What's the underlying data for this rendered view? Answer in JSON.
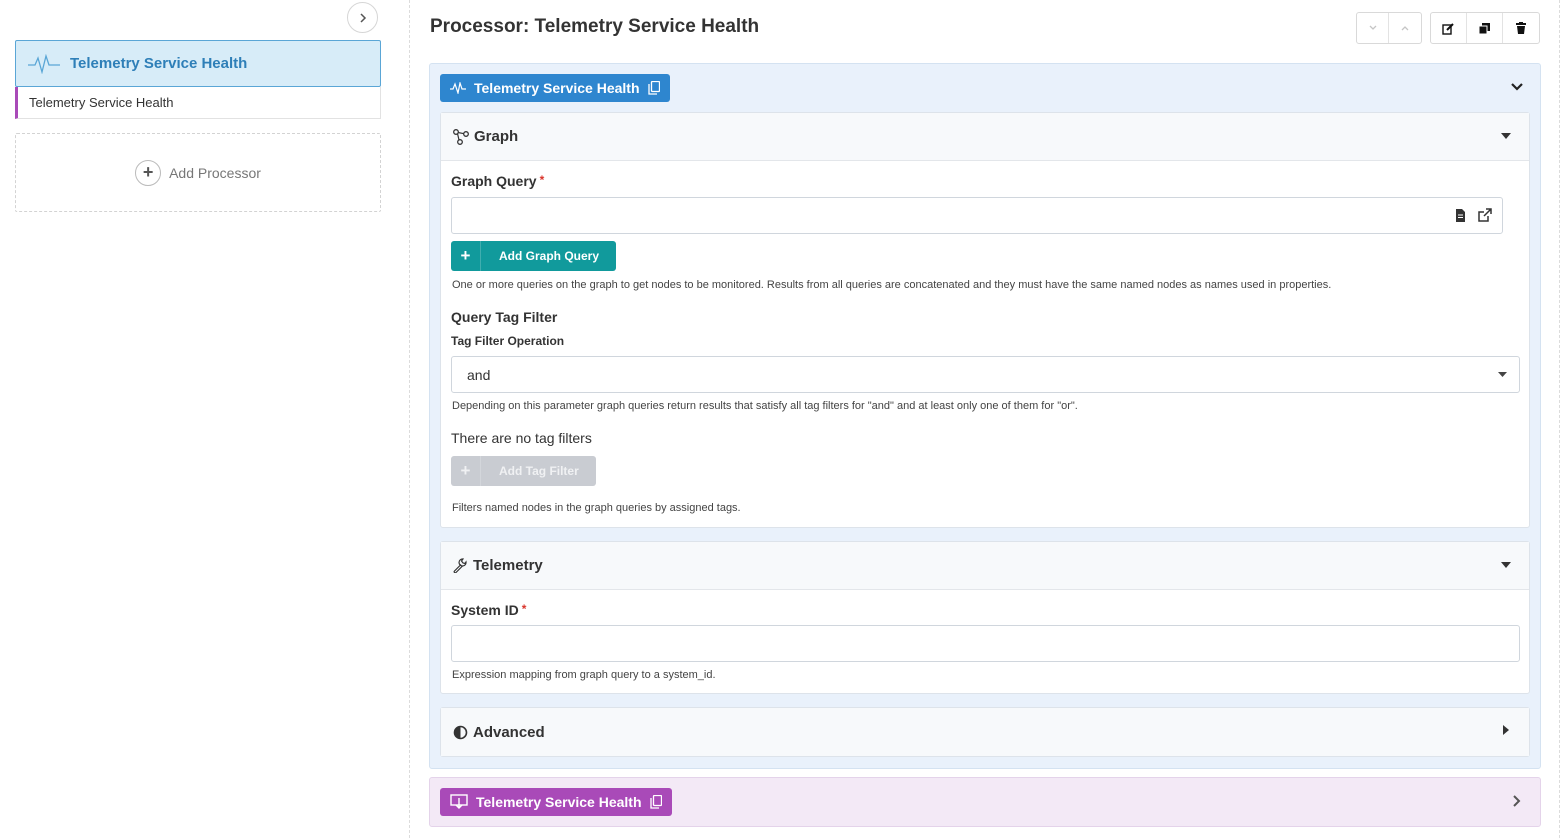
{
  "sidebar": {
    "processor": {
      "title": "Telemetry Service Health",
      "subtitle": "Telemetry Service Health"
    },
    "add_processor_label": "Add Processor"
  },
  "header": {
    "title": "Processor: Telemetry Service Health"
  },
  "processor_badge": {
    "label": "Telemetry Service Health"
  },
  "graph_section": {
    "title": "Graph",
    "graph_query_label": "Graph Query",
    "required_mark": "*",
    "graph_query_value": "",
    "add_graph_query_label": "Add Graph Query",
    "graph_query_help": "One or more queries on the graph to get nodes to be monitored. Results from all queries are concatenated and they must have the same named nodes as names used in properties.",
    "query_tag_filter_label": "Query Tag Filter",
    "tag_filter_operation_label": "Tag Filter Operation",
    "tag_filter_operation_value": "and",
    "tag_filter_operation_help": "Depending on this parameter graph queries return results that satisfy all tag filters for \"and\" and at least only one of them for \"or\".",
    "no_tag_filters_text": "There are no tag filters",
    "add_tag_filter_label": "Add Tag Filter",
    "tag_filter_help": "Filters named nodes in the graph queries by assigned tags."
  },
  "telemetry_section": {
    "title": "Telemetry",
    "system_id_label": "System ID",
    "required_mark": "*",
    "system_id_value": "",
    "system_id_help": "Expression mapping from graph query to a system_id."
  },
  "advanced_section": {
    "title": "Advanced"
  },
  "sink_badge": {
    "label": "Telemetry Service Health"
  },
  "colors": {
    "processor_blue": "#2e86cf",
    "sink_purple": "#a94ab8",
    "teal_button": "#119a9c",
    "required_red": "#d9342b"
  }
}
